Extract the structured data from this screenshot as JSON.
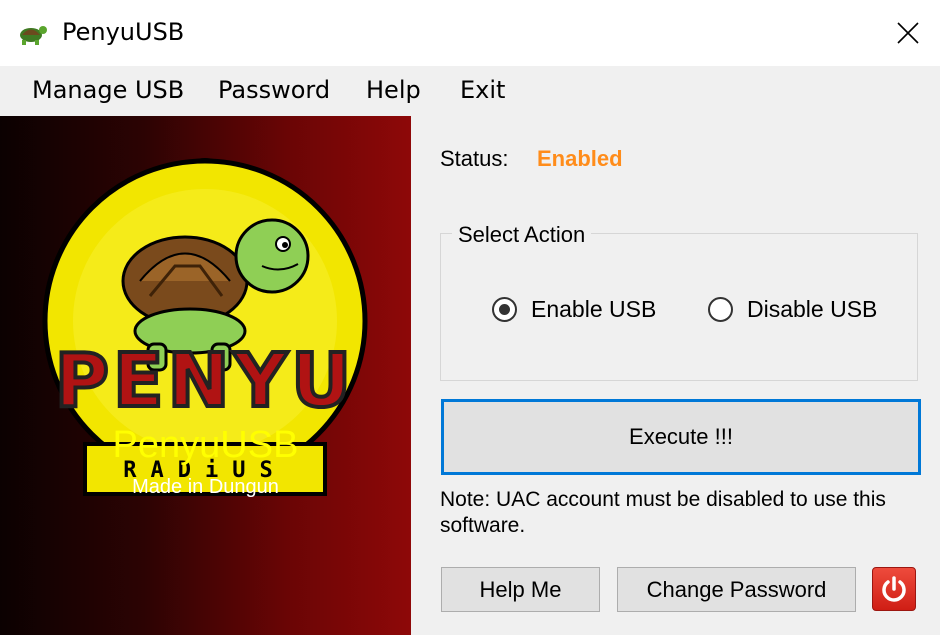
{
  "window": {
    "title": "PenyuUSB",
    "app_icon": "turtle-icon",
    "close_icon": "close-icon"
  },
  "menu": {
    "items": [
      {
        "label": "Manage USB"
      },
      {
        "label": "Password"
      },
      {
        "label": "Help"
      },
      {
        "label": "Exit"
      }
    ]
  },
  "brand": {
    "logo_word": "PENYU",
    "logo_badge": "RADiUS",
    "name": "PenyuUSB",
    "tagline": "Made in Dungun"
  },
  "status": {
    "label": "Status:",
    "value": "Enabled",
    "value_color": "#ff8c1a"
  },
  "select_action": {
    "legend": "Select Action",
    "options": [
      {
        "label": "Enable USB",
        "selected": true
      },
      {
        "label": "Disable USB",
        "selected": false
      }
    ]
  },
  "execute": {
    "label": "Execute !!!",
    "focus_color": "#0078d7"
  },
  "note": "Note: UAC account must be disabled to use this software.",
  "buttons": {
    "help": "Help Me",
    "change_password": "Change Password",
    "power_icon": "power-icon"
  }
}
